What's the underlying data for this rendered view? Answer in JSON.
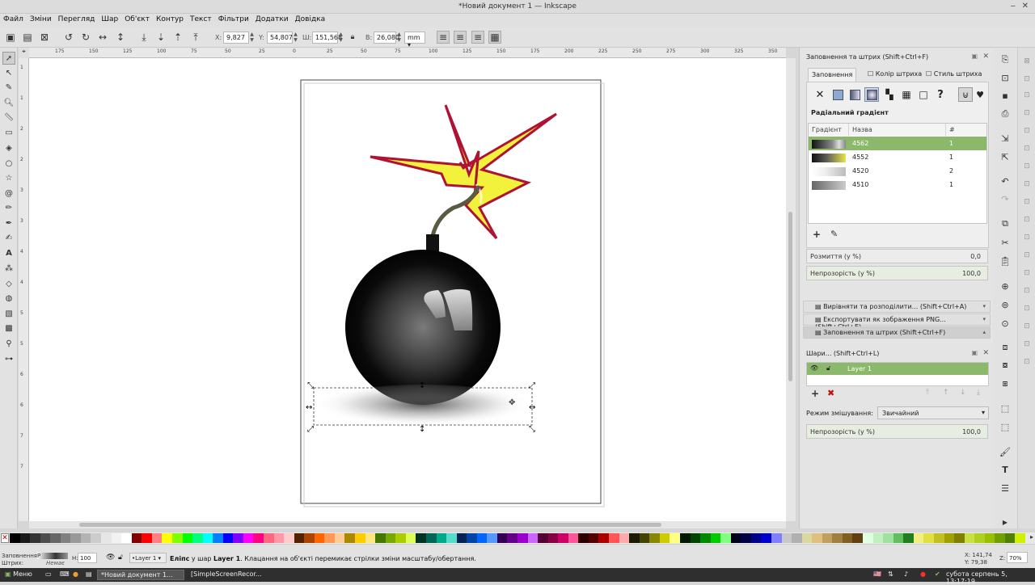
{
  "window": {
    "title": "*Новий документ 1 — Inkscape"
  },
  "menu": [
    "Файл",
    "Зміни",
    "Перегляд",
    "Шар",
    "Об'єкт",
    "Контур",
    "Текст",
    "Фільтри",
    "Додатки",
    "Довідка"
  ],
  "controls": {
    "x_label": "X:",
    "x_value": "9,827",
    "y_label": "Y:",
    "y_value": "54,807",
    "w_label": "Ш:",
    "w_value": "151,568",
    "h_label": "В:",
    "h_value": "26,080",
    "unit": "mm"
  },
  "ruler": {
    "h_labels": [
      "175",
      "150",
      "125",
      "100",
      "75",
      "50",
      "25",
      "0",
      "25",
      "50",
      "75",
      "100",
      "125",
      "150",
      "175",
      "200",
      "225",
      "250",
      "275",
      "300",
      "325",
      "350"
    ],
    "v_labels": [
      "1",
      "1",
      "2",
      "2",
      "3",
      "3",
      "4",
      "4",
      "5",
      "5",
      "6",
      "6",
      "7",
      "7"
    ]
  },
  "fill_panel": {
    "title": "Заповнення та штрих (Shift+Ctrl+F)",
    "tabs": [
      "Заповнення",
      "Колір штриха",
      "Стиль штриха"
    ],
    "type_label": "Радіальний градієнт",
    "columns": [
      "Градієнт",
      "Назва",
      "#"
    ],
    "gradients": [
      {
        "name": "4562",
        "count": "1"
      },
      {
        "name": "4552",
        "count": "1"
      },
      {
        "name": "4520",
        "count": "2"
      },
      {
        "name": "4510",
        "count": "1"
      }
    ],
    "blur_label": "Розмиття (у %)",
    "blur_value": "0,0",
    "opacity_label": "Непрозорість (у %)",
    "opacity_value": "100,0"
  },
  "collapsed_panels": [
    "Вирівняти та розподілити... (Shift+Ctrl+A)",
    "Експортувати як зображення PNG... (Shift+Ctrl+E)",
    "Заповнення та штрих (Shift+Ctrl+F)"
  ],
  "layers_panel": {
    "title": "Шари... (Shift+Ctrl+L)",
    "layer_name": "Layer 1",
    "blend_label": "Режим змішування:",
    "blend_value": "Звичайний",
    "opacity_label": "Непрозорість (у %)",
    "opacity_value": "100,0"
  },
  "status": {
    "fill_label": "Заповнення:",
    "fill_value": "Р",
    "stroke_label": "Штрих:",
    "stroke_value": "Немає",
    "opacity_label": "Н:",
    "opacity_value": "100",
    "layer_select": "•Layer 1",
    "object_type": "Еліпс",
    "message_pre": " у шар ",
    "message_layer": "Layer 1",
    "message_post": ". Клацання на об'єкті перемикає стрілки зміни масштабу/обертання.",
    "cursor_x": "X: 141,74",
    "cursor_y": "Y: 79,38",
    "zoom_label": "Z:",
    "zoom_value": "70%"
  },
  "taskbar": {
    "menu_label": "Меню",
    "task1": "*Новий документ 1...",
    "task2": "[SimpleScreenRecor...",
    "clock": "субота серпень 5, 13:17:19"
  },
  "colors": {
    "accent": "#8bb86a",
    "star_fill": "#f2f23c",
    "star_stroke": "#b01233"
  }
}
